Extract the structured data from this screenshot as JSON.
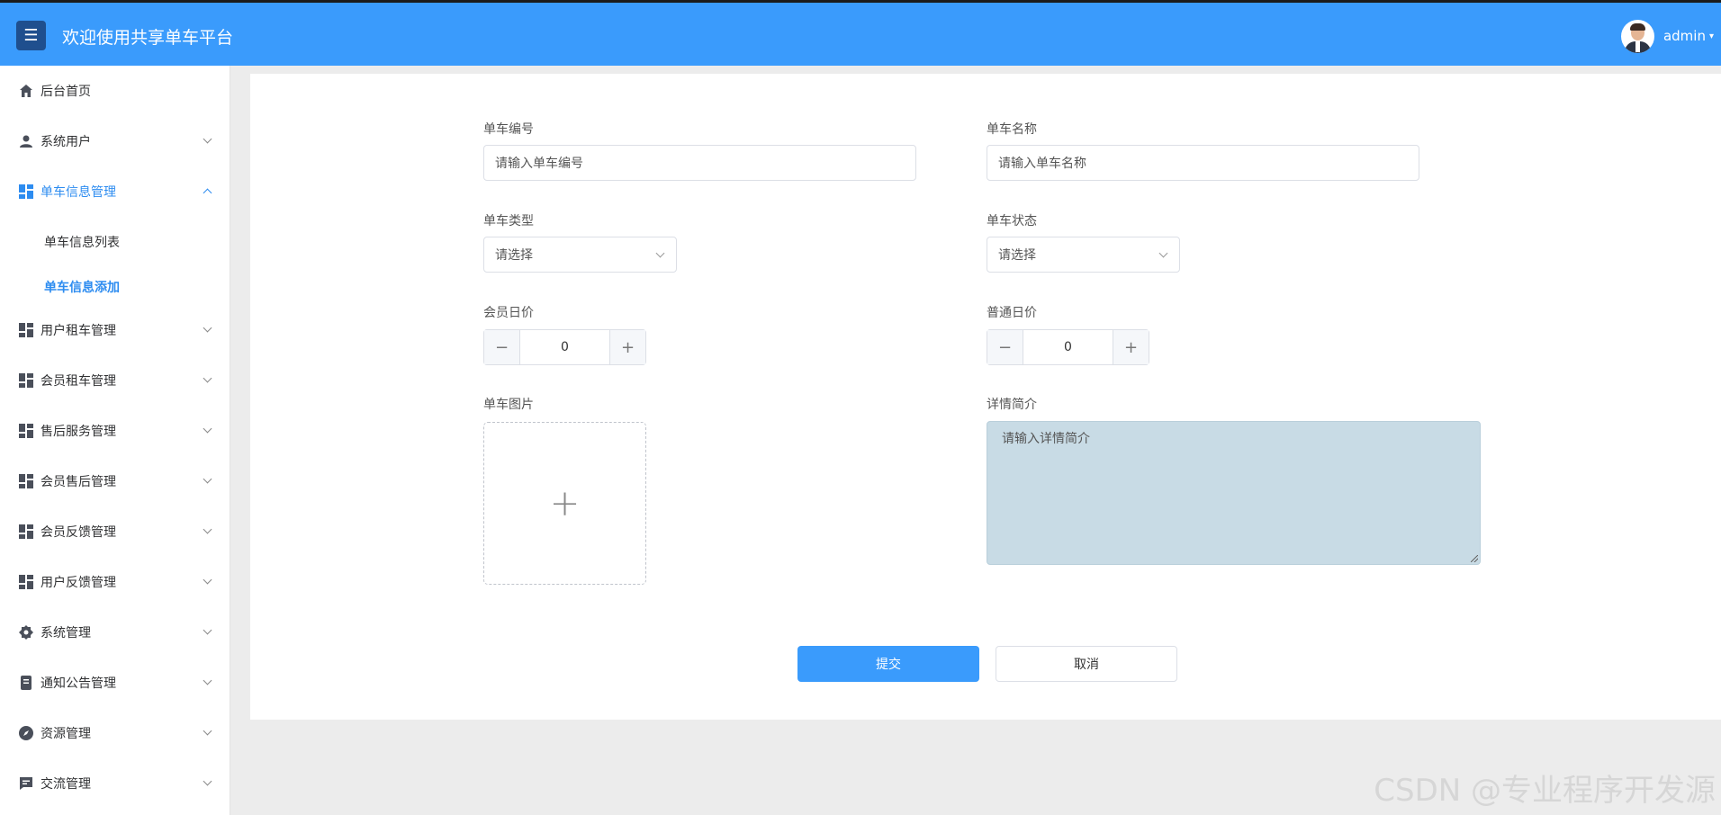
{
  "header": {
    "menu_toggle": "☰",
    "title": "欢迎使用共享单车平台",
    "user_name": "admin",
    "user_caret": "▾"
  },
  "sidebar": {
    "items": [
      {
        "label": "后台首页",
        "icon": "home-icon"
      },
      {
        "label": "系统用户",
        "icon": "user-icon"
      },
      {
        "label": "单车信息管理",
        "icon": "grid-icon",
        "expanded": true
      },
      {
        "label": "用户租车管理",
        "icon": "grid-icon"
      },
      {
        "label": "会员租车管理",
        "icon": "grid-icon"
      },
      {
        "label": "售后服务管理",
        "icon": "grid-icon"
      },
      {
        "label": "会员售后管理",
        "icon": "grid-icon"
      },
      {
        "label": "会员反馈管理",
        "icon": "grid-icon"
      },
      {
        "label": "用户反馈管理",
        "icon": "grid-icon"
      },
      {
        "label": "系统管理",
        "icon": "gear-icon"
      },
      {
        "label": "通知公告管理",
        "icon": "notice-icon"
      },
      {
        "label": "资源管理",
        "icon": "compass-icon"
      },
      {
        "label": "交流管理",
        "icon": "chat-icon"
      }
    ],
    "sub_items": [
      {
        "label": "单车信息列表"
      },
      {
        "label": "单车信息添加",
        "active": true
      }
    ]
  },
  "form": {
    "bike_no": {
      "label": "单车编号",
      "placeholder": "请输入单车编号"
    },
    "bike_name": {
      "label": "单车名称",
      "placeholder": "请输入单车名称"
    },
    "bike_type": {
      "label": "单车类型",
      "placeholder": "请选择"
    },
    "bike_status": {
      "label": "单车状态",
      "placeholder": "请选择"
    },
    "member_price": {
      "label": "会员日价",
      "value": "0"
    },
    "normal_price": {
      "label": "普通日价",
      "value": "0"
    },
    "bike_image": {
      "label": "单车图片",
      "plus": "+"
    },
    "description": {
      "label": "详情简介",
      "placeholder": "请输入详情简介"
    },
    "submit_label": "提交",
    "cancel_label": "取消",
    "minus_symbol": "−",
    "plus_symbol": "+"
  },
  "watermark": "CSDN @专业程序开发源",
  "colors": {
    "accent": "#3a9bfc",
    "active": "#2d8cf0",
    "textarea_bg": "#c8dbe5"
  }
}
